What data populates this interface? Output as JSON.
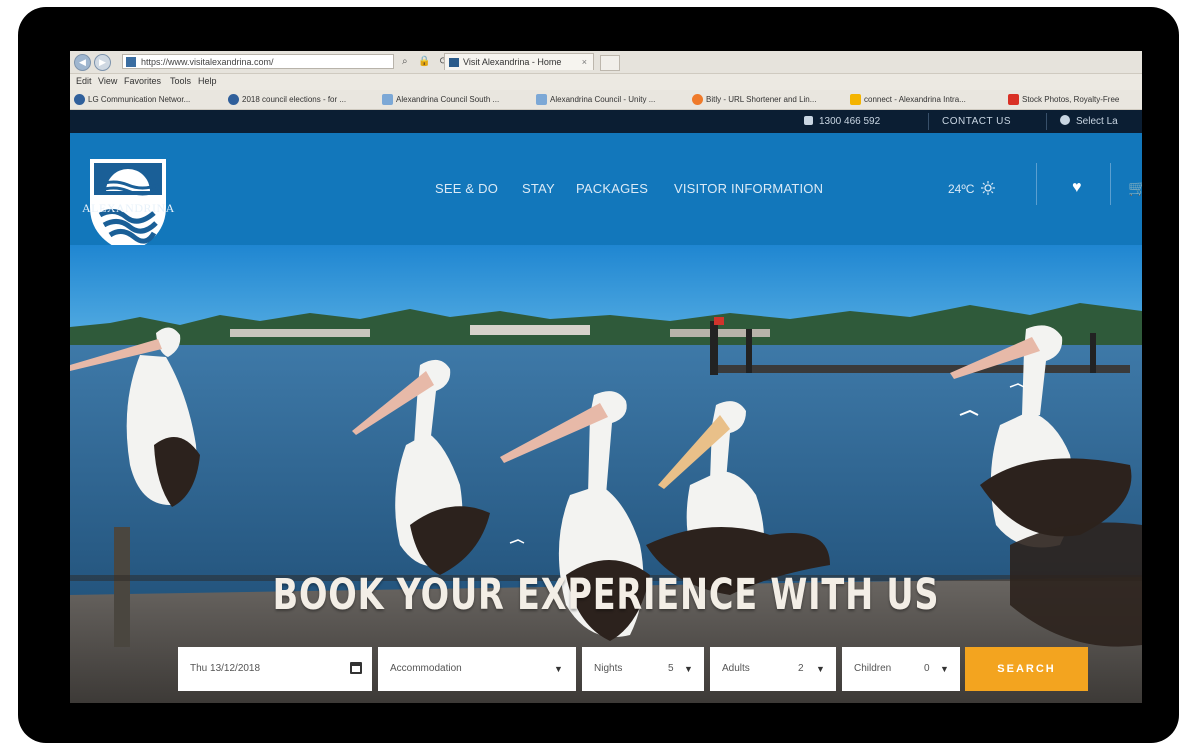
{
  "browser": {
    "url": "https://www.visitalexandrina.com/",
    "tab_title": "Visit Alexandrina - Home",
    "tab_close": "×",
    "menu": [
      "Edit",
      "View",
      "Favorites",
      "Tools",
      "Help"
    ],
    "favorites": [
      "LG Communication Networ...",
      "2018 council elections - for ...",
      "Alexandrina Council South ...",
      "Alexandrina Council - Unity ...",
      "Bitly - URL Shortener and Lin...",
      "connect - Alexandrina Intra...",
      "Stock Photos, Royalty-Free"
    ]
  },
  "topbar": {
    "phone": "1300 466 592",
    "contact": "CONTACT US",
    "language": "Select La"
  },
  "header": {
    "logo_text": "ALEXANDRINA",
    "nav": [
      "SEE & DO",
      "STAY",
      "PACKAGES",
      "VISITOR INFORMATION"
    ],
    "weather": "24ºC",
    "weather_icon": "sun-icon",
    "heart_glyph": "♥",
    "cart_glyph": "🛒"
  },
  "hero": {
    "headline": "BOOK YOUR EXPERIENCE WITH US"
  },
  "search_form": {
    "date": "Thu 13/12/2018",
    "category": "Accommodation",
    "nights_label": "Nights",
    "nights_value": "5",
    "adults_label": "Adults",
    "adults_value": "2",
    "children_label": "Children",
    "children_value": "0",
    "search_label": "SEARCH"
  },
  "colors": {
    "header_blue": "#1277bb",
    "topbar_navy": "#0b1e33",
    "search_orange": "#f3a41f"
  }
}
